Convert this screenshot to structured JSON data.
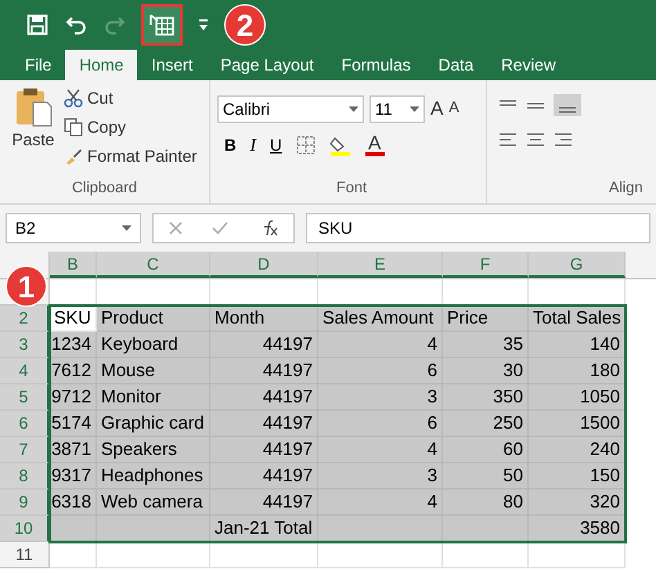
{
  "quick_access": {
    "items": [
      {
        "kind": "save",
        "highlighted": false
      },
      {
        "kind": "undo",
        "highlighted": false
      },
      {
        "kind": "redo",
        "highlighted": false
      },
      {
        "kind": "table",
        "highlighted": true
      },
      {
        "kind": "customize",
        "highlighted": false
      }
    ],
    "badge": "2"
  },
  "tabs": [
    {
      "label": "File",
      "selected": false
    },
    {
      "label": "Home",
      "selected": true
    },
    {
      "label": "Insert",
      "selected": false
    },
    {
      "label": "Page Layout",
      "selected": false
    },
    {
      "label": "Formulas",
      "selected": false
    },
    {
      "label": "Data",
      "selected": false
    },
    {
      "label": "Review",
      "selected": false
    }
  ],
  "clipboard": {
    "paste": "Paste",
    "cut": "Cut",
    "copy": "Copy",
    "format_painter": "Format Painter",
    "title": "Clipboard"
  },
  "font": {
    "name": "Calibri",
    "size": "11",
    "grow": "A",
    "shrink": "A",
    "bold": "B",
    "italic": "I",
    "underline": "U",
    "color_letter": "A",
    "title": "Font"
  },
  "alignment": {
    "title": "Align"
  },
  "formula_bar": {
    "name_box": "B2",
    "value": "SKU"
  },
  "sheet": {
    "badge": "1",
    "columns": [
      {
        "label": "B",
        "selected": true
      },
      {
        "label": "C",
        "selected": true
      },
      {
        "label": "D",
        "selected": true
      },
      {
        "label": "E",
        "selected": true
      },
      {
        "label": "F",
        "selected": true
      },
      {
        "label": "G",
        "selected": true
      }
    ],
    "rows": [
      {
        "selected": false,
        "cells": [
          "",
          "",
          "",
          "",
          "",
          ""
        ]
      },
      {
        "header": "2",
        "selected": true,
        "cells": [
          "SKU",
          "Product",
          "Month",
          "Sales Amount",
          "Price",
          "Total Sales"
        ]
      },
      {
        "header": "3",
        "selected": true,
        "cells": [
          "1234",
          "Keyboard",
          "44197",
          "4",
          "35",
          "140"
        ]
      },
      {
        "header": "4",
        "selected": true,
        "cells": [
          "7612",
          "Mouse",
          "44197",
          "6",
          "30",
          "180"
        ]
      },
      {
        "header": "5",
        "selected": true,
        "cells": [
          "9712",
          "Monitor",
          "44197",
          "3",
          "350",
          "1050"
        ]
      },
      {
        "header": "6",
        "selected": true,
        "cells": [
          "5174",
          "Graphic card",
          "44197",
          "6",
          "250",
          "1500"
        ]
      },
      {
        "header": "7",
        "selected": true,
        "cells": [
          "3871",
          "Speakers",
          "44197",
          "4",
          "60",
          "240"
        ]
      },
      {
        "header": "8",
        "selected": true,
        "cells": [
          "9317",
          "Headphones",
          "44197",
          "3",
          "50",
          "150"
        ]
      },
      {
        "header": "9",
        "selected": true,
        "cells": [
          "6318",
          "Web camera",
          "44197",
          "4",
          "80",
          "320"
        ]
      },
      {
        "header": "10",
        "selected": true,
        "cells": [
          "",
          "",
          "Jan-21 Total",
          "",
          "",
          "3580"
        ]
      },
      {
        "header": "11",
        "selected": false,
        "cells": [
          "",
          "",
          "",
          "",
          "",
          ""
        ]
      }
    ]
  }
}
